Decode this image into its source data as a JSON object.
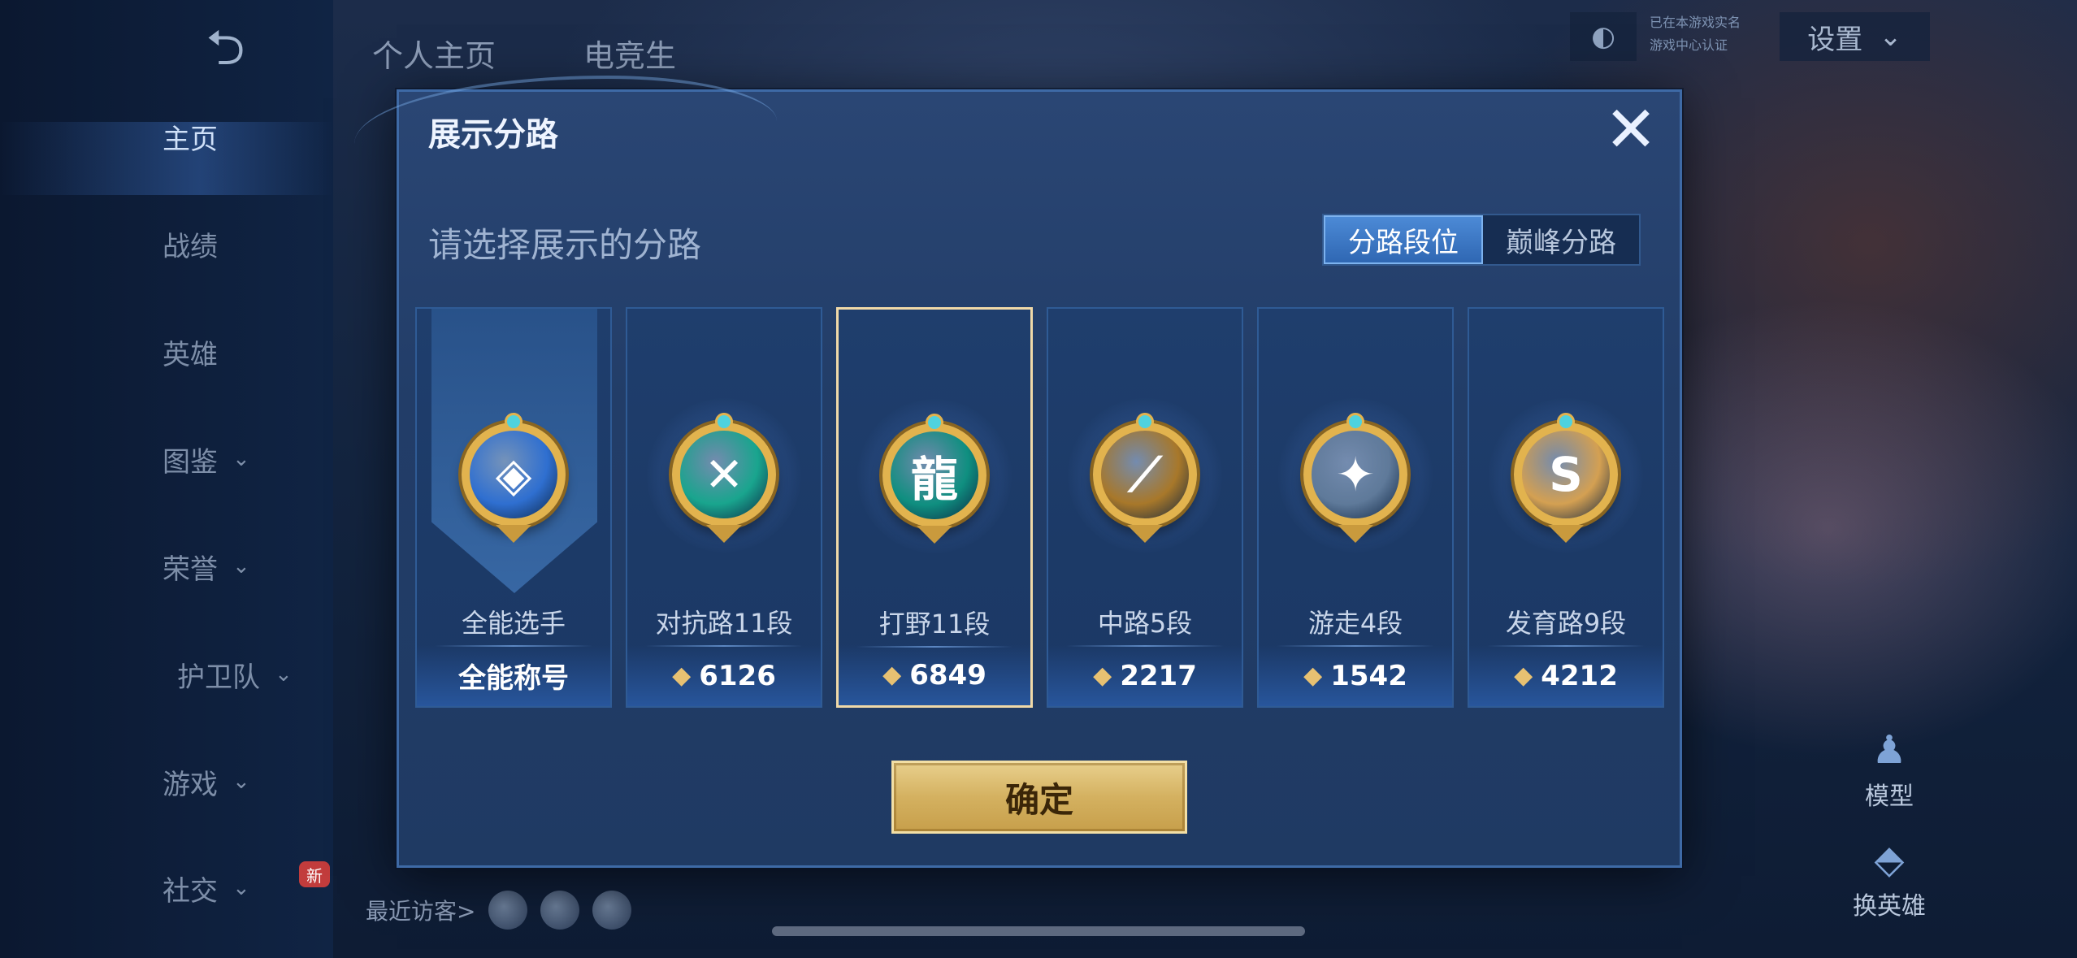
{
  "nav": {
    "back_icon": "back-arrow-icon",
    "items": [
      {
        "label": "主页",
        "active": true,
        "chevron": false
      },
      {
        "label": "战绩",
        "active": false,
        "chevron": false
      },
      {
        "label": "英雄",
        "active": false,
        "chevron": false
      },
      {
        "label": "图鉴",
        "active": false,
        "chevron": true
      },
      {
        "label": "荣誉",
        "active": false,
        "chevron": true
      },
      {
        "label": "护卫队",
        "active": false,
        "chevron": true
      },
      {
        "label": "游戏",
        "active": false,
        "chevron": true
      },
      {
        "label": "社交",
        "active": false,
        "chevron": true
      }
    ],
    "new_badge": "新"
  },
  "top": {
    "tab_profile": "个人主页",
    "tab_esports": "电竞生",
    "settings_label": "设置",
    "status_line1": "已在本游戏实名",
    "status_line2": "游戏中心认证"
  },
  "right": {
    "model_label": "模型",
    "switch_hero_label": "换英雄"
  },
  "visitors": {
    "label": "最近访客>"
  },
  "modal": {
    "title": "展示分路",
    "subtitle": "请选择展示的分路",
    "seg_lane_rank": "分路段位",
    "seg_peak_lane": "巅峰分路",
    "confirm_label": "确定",
    "cards": [
      {
        "label": "全能选手",
        "footer": "全能称号",
        "score": null,
        "selected": false,
        "badge_color": "#2f6fd0",
        "glyph": "◈"
      },
      {
        "label": "对抗路11段",
        "footer": null,
        "score": "6126",
        "selected": false,
        "badge_color": "#19a58e",
        "glyph": "✕"
      },
      {
        "label": "打野11段",
        "footer": null,
        "score": "6849",
        "selected": true,
        "badge_color": "#0f8f80",
        "glyph": "龍"
      },
      {
        "label": "中路5段",
        "footer": null,
        "score": "2217",
        "selected": false,
        "badge_color": "#a8782a",
        "glyph": "⟋"
      },
      {
        "label": "游走4段",
        "footer": null,
        "score": "1542",
        "selected": false,
        "badge_color": "#5f7a9a",
        "glyph": "✦"
      },
      {
        "label": "发育路9段",
        "footer": null,
        "score": "4212",
        "selected": false,
        "badge_color": "#d4a052",
        "glyph": "S"
      }
    ]
  },
  "colors": {
    "accent_gold": "#e2b34e",
    "modal_bg": "#223d68",
    "selected_border": "#f0d9a8"
  }
}
